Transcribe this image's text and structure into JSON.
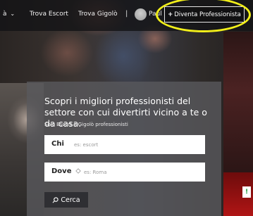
{
  "nav": {
    "partial_item": "à",
    "chevron": "⌄",
    "trova_escort": "Trova Escort",
    "trova_gigolo": "Trova Gigolò",
    "divider": "|",
    "user_name": "Paul",
    "pro_button_plus": "+",
    "pro_button_label": "Diventa Professionista"
  },
  "hero": {
    "headline": "Scopri i migliori professionisti del settore con cui divertirti vicino a te o da casa.",
    "subline": "Solo Escort e Gigolò professionisti"
  },
  "search": {
    "who_label": "Chi",
    "who_placeholder": "es: escort",
    "where_label": "Dove",
    "where_placeholder": "es: Roma",
    "button_label": "Cerca"
  },
  "side_badge": "!",
  "colors": {
    "highlight": "#f2ef1a",
    "panel": "#5a5a5e",
    "button": "#2f2f33"
  }
}
